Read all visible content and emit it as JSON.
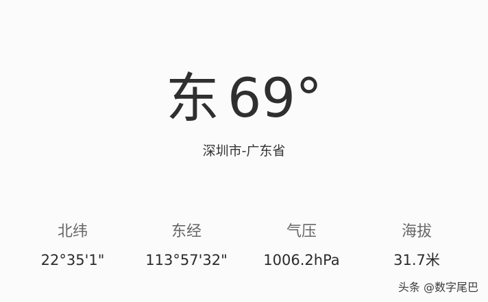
{
  "compass": {
    "direction": "东",
    "degrees": "69°"
  },
  "location": "深圳市-广东省",
  "stats": [
    {
      "label": "北纬",
      "value": "22°35'1\""
    },
    {
      "label": "东经",
      "value": "113°57'32\""
    },
    {
      "label": "气压",
      "value": "1006.2hPa"
    },
    {
      "label": "海拔",
      "value": "31.7米"
    }
  ],
  "watermark": "头条 @数字尾巴"
}
